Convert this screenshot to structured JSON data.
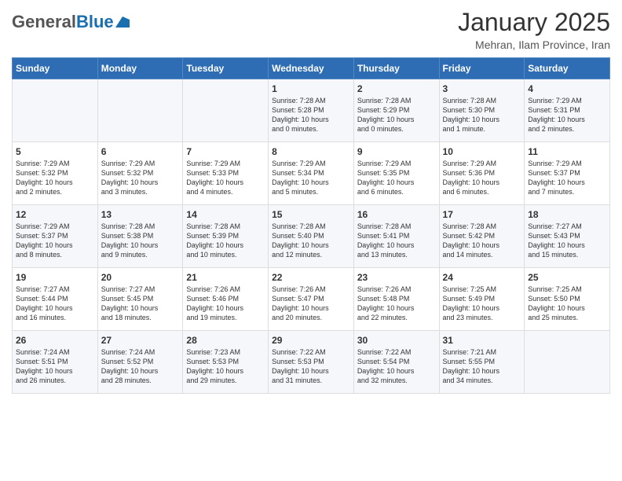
{
  "header": {
    "logo_general": "General",
    "logo_blue": "Blue",
    "title": "January 2025",
    "subtitle": "Mehran, Ilam Province, Iran"
  },
  "weekdays": [
    "Sunday",
    "Monday",
    "Tuesday",
    "Wednesday",
    "Thursday",
    "Friday",
    "Saturday"
  ],
  "weeks": [
    [
      {
        "day": "",
        "content": ""
      },
      {
        "day": "",
        "content": ""
      },
      {
        "day": "",
        "content": ""
      },
      {
        "day": "1",
        "content": "Sunrise: 7:28 AM\nSunset: 5:28 PM\nDaylight: 10 hours\nand 0 minutes."
      },
      {
        "day": "2",
        "content": "Sunrise: 7:28 AM\nSunset: 5:29 PM\nDaylight: 10 hours\nand 0 minutes."
      },
      {
        "day": "3",
        "content": "Sunrise: 7:28 AM\nSunset: 5:30 PM\nDaylight: 10 hours\nand 1 minute."
      },
      {
        "day": "4",
        "content": "Sunrise: 7:29 AM\nSunset: 5:31 PM\nDaylight: 10 hours\nand 2 minutes."
      }
    ],
    [
      {
        "day": "5",
        "content": "Sunrise: 7:29 AM\nSunset: 5:32 PM\nDaylight: 10 hours\nand 2 minutes."
      },
      {
        "day": "6",
        "content": "Sunrise: 7:29 AM\nSunset: 5:32 PM\nDaylight: 10 hours\nand 3 minutes."
      },
      {
        "day": "7",
        "content": "Sunrise: 7:29 AM\nSunset: 5:33 PM\nDaylight: 10 hours\nand 4 minutes."
      },
      {
        "day": "8",
        "content": "Sunrise: 7:29 AM\nSunset: 5:34 PM\nDaylight: 10 hours\nand 5 minutes."
      },
      {
        "day": "9",
        "content": "Sunrise: 7:29 AM\nSunset: 5:35 PM\nDaylight: 10 hours\nand 6 minutes."
      },
      {
        "day": "10",
        "content": "Sunrise: 7:29 AM\nSunset: 5:36 PM\nDaylight: 10 hours\nand 6 minutes."
      },
      {
        "day": "11",
        "content": "Sunrise: 7:29 AM\nSunset: 5:37 PM\nDaylight: 10 hours\nand 7 minutes."
      }
    ],
    [
      {
        "day": "12",
        "content": "Sunrise: 7:29 AM\nSunset: 5:37 PM\nDaylight: 10 hours\nand 8 minutes."
      },
      {
        "day": "13",
        "content": "Sunrise: 7:28 AM\nSunset: 5:38 PM\nDaylight: 10 hours\nand 9 minutes."
      },
      {
        "day": "14",
        "content": "Sunrise: 7:28 AM\nSunset: 5:39 PM\nDaylight: 10 hours\nand 10 minutes."
      },
      {
        "day": "15",
        "content": "Sunrise: 7:28 AM\nSunset: 5:40 PM\nDaylight: 10 hours\nand 12 minutes."
      },
      {
        "day": "16",
        "content": "Sunrise: 7:28 AM\nSunset: 5:41 PM\nDaylight: 10 hours\nand 13 minutes."
      },
      {
        "day": "17",
        "content": "Sunrise: 7:28 AM\nSunset: 5:42 PM\nDaylight: 10 hours\nand 14 minutes."
      },
      {
        "day": "18",
        "content": "Sunrise: 7:27 AM\nSunset: 5:43 PM\nDaylight: 10 hours\nand 15 minutes."
      }
    ],
    [
      {
        "day": "19",
        "content": "Sunrise: 7:27 AM\nSunset: 5:44 PM\nDaylight: 10 hours\nand 16 minutes."
      },
      {
        "day": "20",
        "content": "Sunrise: 7:27 AM\nSunset: 5:45 PM\nDaylight: 10 hours\nand 18 minutes."
      },
      {
        "day": "21",
        "content": "Sunrise: 7:26 AM\nSunset: 5:46 PM\nDaylight: 10 hours\nand 19 minutes."
      },
      {
        "day": "22",
        "content": "Sunrise: 7:26 AM\nSunset: 5:47 PM\nDaylight: 10 hours\nand 20 minutes."
      },
      {
        "day": "23",
        "content": "Sunrise: 7:26 AM\nSunset: 5:48 PM\nDaylight: 10 hours\nand 22 minutes."
      },
      {
        "day": "24",
        "content": "Sunrise: 7:25 AM\nSunset: 5:49 PM\nDaylight: 10 hours\nand 23 minutes."
      },
      {
        "day": "25",
        "content": "Sunrise: 7:25 AM\nSunset: 5:50 PM\nDaylight: 10 hours\nand 25 minutes."
      }
    ],
    [
      {
        "day": "26",
        "content": "Sunrise: 7:24 AM\nSunset: 5:51 PM\nDaylight: 10 hours\nand 26 minutes."
      },
      {
        "day": "27",
        "content": "Sunrise: 7:24 AM\nSunset: 5:52 PM\nDaylight: 10 hours\nand 28 minutes."
      },
      {
        "day": "28",
        "content": "Sunrise: 7:23 AM\nSunset: 5:53 PM\nDaylight: 10 hours\nand 29 minutes."
      },
      {
        "day": "29",
        "content": "Sunrise: 7:22 AM\nSunset: 5:53 PM\nDaylight: 10 hours\nand 31 minutes."
      },
      {
        "day": "30",
        "content": "Sunrise: 7:22 AM\nSunset: 5:54 PM\nDaylight: 10 hours\nand 32 minutes."
      },
      {
        "day": "31",
        "content": "Sunrise: 7:21 AM\nSunset: 5:55 PM\nDaylight: 10 hours\nand 34 minutes."
      },
      {
        "day": "",
        "content": ""
      }
    ]
  ]
}
